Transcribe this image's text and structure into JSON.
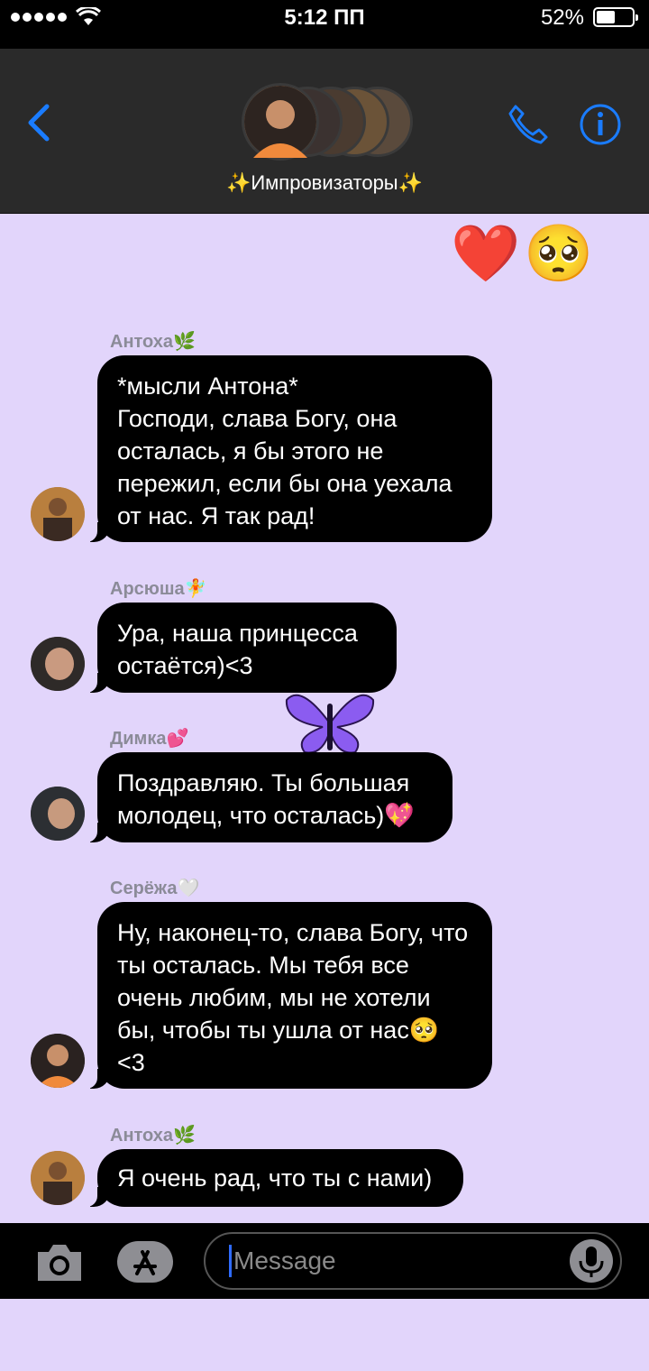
{
  "status_bar": {
    "time": "5:12 ПП",
    "battery": "52%",
    "battery_level": 0.52
  },
  "header": {
    "group_name": "✨Импровизаторы✨"
  },
  "top_reactions": [
    "❤️",
    "🥺"
  ],
  "messages": [
    {
      "sender": "Антоха🌿",
      "text": "*мысли Антона*\nГосподи, слава Богу, она осталась, я бы этого не пережил, если бы она уехала от нас. Я так рад!"
    },
    {
      "sender": "Арсюша🧚",
      "text": "Ура, наша принцесса остаётся)<3"
    },
    {
      "sender": "Димка💕",
      "text": "Поздравляю. Ты большая молодец, что осталась)💖"
    },
    {
      "sender": "Серёжа🤍",
      "text": "Ну, наконец-то, слава Богу, что ты осталась. Мы тебя все очень любим, мы не хотели бы, чтобы ты ушла от нас🥺\n<3"
    },
    {
      "sender": "Антоха🌿",
      "text": "Я очень рад, что ты с нами)"
    }
  ],
  "decoration": {
    "butterfly": "purple-butterfly"
  },
  "composer": {
    "placeholder": "Message"
  },
  "icons": {
    "back": "chevron-left-icon",
    "call": "phone-icon",
    "info": "info-icon",
    "camera": "camera-icon",
    "apps": "app-store-icon",
    "mic": "microphone-icon"
  },
  "colors": {
    "accent": "#1a7cff",
    "chat_bg": "#e2d5fb",
    "bubble": "#000000"
  }
}
